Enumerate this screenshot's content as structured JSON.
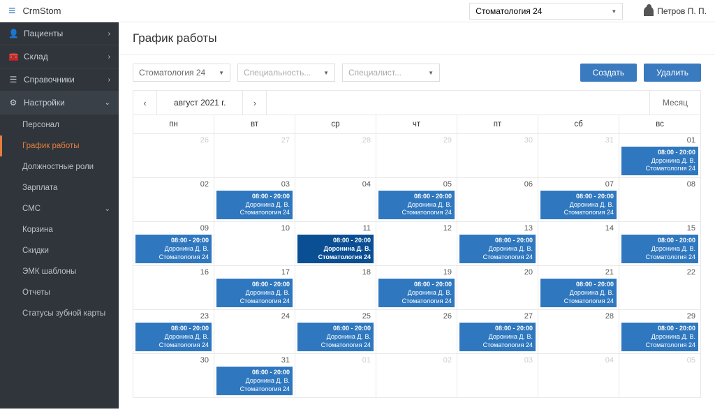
{
  "app_title": "CrmStom",
  "top_select": "Стоматология 24",
  "user_name": "Петров П. П.",
  "sidebar": {
    "patients": "Пациенты",
    "warehouse": "Склад",
    "directories": "Справочники",
    "settings": "Настройки",
    "subs": {
      "personnel": "Персонал",
      "schedule": "График работы",
      "roles": "Должностные роли",
      "salary": "Зарплата",
      "sms": "СМС",
      "trash": "Корзина",
      "discounts": "Скидки",
      "emk": "ЭМК шаблоны",
      "reports": "Отчеты",
      "tooth_statuses": "Статусы зубной карты"
    }
  },
  "page_title": "График работы",
  "filters": {
    "branch": "Стоматология 24",
    "speciality_placeholder": "Специальность...",
    "specialist_placeholder": "Специалист..."
  },
  "buttons": {
    "create": "Создать",
    "delete": "Удалить"
  },
  "calendar": {
    "month_label": "август 2021 г.",
    "view_tab": "Месяц",
    "weekdays": [
      "пн",
      "вт",
      "ср",
      "чт",
      "пт",
      "сб",
      "вс"
    ],
    "event_template": {
      "time": "08:00 - 20:00",
      "person": "Доронина Д. В.",
      "branch": "Стоматология 24"
    },
    "cells": [
      {
        "n": "26",
        "out": true
      },
      {
        "n": "27",
        "out": true
      },
      {
        "n": "28",
        "out": true
      },
      {
        "n": "29",
        "out": true
      },
      {
        "n": "30",
        "out": true
      },
      {
        "n": "31",
        "out": true
      },
      {
        "n": "01",
        "ev": true
      },
      {
        "n": "02"
      },
      {
        "n": "03",
        "ev": true
      },
      {
        "n": "04"
      },
      {
        "n": "05",
        "ev": true
      },
      {
        "n": "06"
      },
      {
        "n": "07",
        "ev": true
      },
      {
        "n": "08"
      },
      {
        "n": "09",
        "ev": true
      },
      {
        "n": "10"
      },
      {
        "n": "11",
        "ev": true,
        "sel": true
      },
      {
        "n": "12"
      },
      {
        "n": "13",
        "ev": true
      },
      {
        "n": "14"
      },
      {
        "n": "15",
        "ev": true
      },
      {
        "n": "16"
      },
      {
        "n": "17",
        "ev": true
      },
      {
        "n": "18"
      },
      {
        "n": "19",
        "ev": true
      },
      {
        "n": "20"
      },
      {
        "n": "21",
        "ev": true
      },
      {
        "n": "22"
      },
      {
        "n": "23",
        "ev": true
      },
      {
        "n": "24"
      },
      {
        "n": "25",
        "ev": true
      },
      {
        "n": "26"
      },
      {
        "n": "27",
        "ev": true
      },
      {
        "n": "28"
      },
      {
        "n": "29",
        "ev": true
      },
      {
        "n": "30"
      },
      {
        "n": "31",
        "ev": true
      },
      {
        "n": "01",
        "out": true
      },
      {
        "n": "02",
        "out": true
      },
      {
        "n": "03",
        "out": true
      },
      {
        "n": "04",
        "out": true
      },
      {
        "n": "05",
        "out": true
      }
    ]
  }
}
